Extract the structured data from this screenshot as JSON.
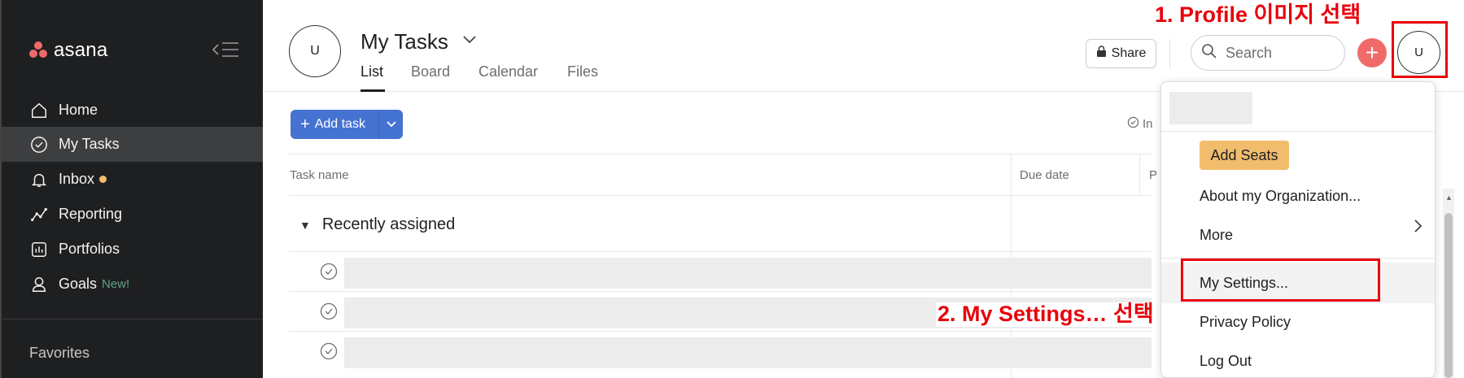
{
  "colors": {
    "sidebar_bg": "#1e1f21",
    "brand_red": "#f06a6a",
    "primary_blue": "#4573d2",
    "add_seats": "#f1bd6c",
    "annotation_red": "#e8000b",
    "new_badge": "#5da283"
  },
  "sidebar": {
    "logo_text": "asana",
    "collapse_icon": "collapse-sidebar-icon",
    "items": [
      {
        "label": "Home",
        "icon": "home-icon",
        "active": false
      },
      {
        "label": "My Tasks",
        "icon": "check-circle-icon",
        "active": true
      },
      {
        "label": "Inbox",
        "icon": "bell-icon",
        "active": false,
        "has_dot": true
      },
      {
        "label": "Reporting",
        "icon": "trend-line-icon",
        "active": false
      },
      {
        "label": "Portfolios",
        "icon": "bar-chart-icon",
        "active": false
      },
      {
        "label": "Goals",
        "icon": "person-icon",
        "active": false,
        "badge": "New!"
      }
    ],
    "favorites_label": "Favorites"
  },
  "header": {
    "avatar_initial": "U",
    "title": "My Tasks",
    "tabs": [
      {
        "label": "List",
        "active": true
      },
      {
        "label": "Board",
        "active": false
      },
      {
        "label": "Calendar",
        "active": false
      },
      {
        "label": "Files",
        "active": false
      }
    ],
    "share_label": "Share",
    "search_placeholder": "Search",
    "plus_label": "+",
    "profile_initial": "U"
  },
  "toolbar": {
    "add_task_label": "Add task",
    "incomplete_label": "In"
  },
  "table": {
    "columns": [
      "Task name",
      "Due date",
      "P"
    ],
    "section_title": "Recently assigned",
    "row_count": 3
  },
  "dropdown": {
    "add_seats_label": "Add Seats",
    "items": [
      "About my Organization...",
      "More",
      "My Settings...",
      "Privacy Policy",
      "Log Out"
    ]
  },
  "annotations": {
    "step1": "1. Profile 이미지 선택",
    "step2": "2. My Settings… 선택"
  }
}
